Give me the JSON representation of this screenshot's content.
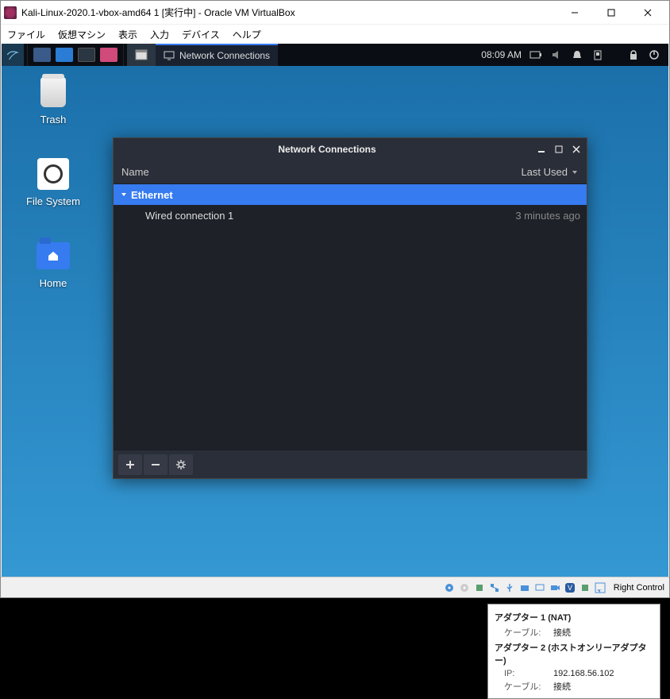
{
  "vbox": {
    "title": "Kali-Linux-2020.1-vbox-amd64 1 [実行中] - Oracle VM VirtualBox",
    "menu": {
      "file": "ファイル",
      "machine": "仮想マシン",
      "view": "表示",
      "input": "入力",
      "devices": "デバイス",
      "help": "ヘルプ"
    },
    "hostkey": "Right Control"
  },
  "panel": {
    "task_active": "Network Connections",
    "clock": "08:09 AM"
  },
  "desktop": {
    "trash": "Trash",
    "filesystem": "File System",
    "home": "Home"
  },
  "nc": {
    "title": "Network Connections",
    "col_name": "Name",
    "col_last": "Last Used",
    "group": "Ethernet",
    "item_name": "Wired connection 1",
    "item_last": "3 minutes ago"
  },
  "tooltip": {
    "adapter1_title": "アダプター 1 (NAT)",
    "cable_label": "ケーブル:",
    "cable_val": "接続",
    "adapter2_title": "アダプター 2 (ホストオンリーアダプター)",
    "ip_label": "IP:",
    "ip_val": "192.168.56.102"
  }
}
